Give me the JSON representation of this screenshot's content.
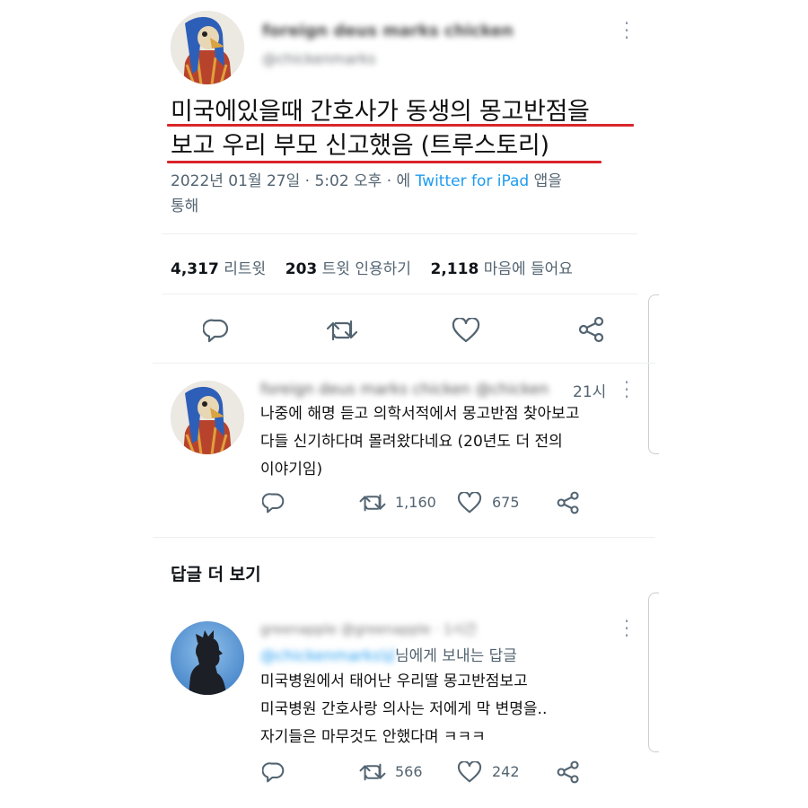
{
  "main_tweet": {
    "author_name": "foreign deus marks chicken",
    "author_handle": "@chickenmarks",
    "text_line1": "미국에있을때 간호사가 동생의 몽고반점을",
    "text_line2": "보고 우리 부모 신고했음 (트루스토리)",
    "meta_prefix": "2022년 01월 27일 · 5:02 오후 · 에 ",
    "meta_client": "Twitter for iPad",
    "meta_suffix_line1": " 앱을",
    "meta_suffix_line2": "통해",
    "retweet_count": "4,317",
    "retweet_label": "리트윗",
    "quote_count": "203",
    "quote_label": "트윗 인용하기",
    "like_count": "2,118",
    "like_label": "마음에 들어요"
  },
  "reply1": {
    "author_name": "foreign deus marks chicken @chicken",
    "time": "21시",
    "text_line1": "나중에 해명 듣고 의학서적에서 몽고반점 찾아보고",
    "text_line2": "다들 신기하다며 몰려왔다네요 (20년도 더 전의",
    "text_line3": "이야기임)",
    "retweet_count": "1,160",
    "like_count": "675"
  },
  "more_replies_title": "답글 더 보기",
  "reply2": {
    "author_name": "greenapple @greenapple · 1시간",
    "reply_to_blurred": "@chickenmarks님",
    "reply_to_suffix": "님에게 보내는 답글",
    "text_line1": "미국병원에서 태어난 우리딸 몽고반점보고",
    "text_line2": "미국병원 간호사랑 의사는 저에게 막 변명을..",
    "text_line3": "자기들은 마무것도 안했다며 ㅋㅋㅋ",
    "retweet_count": "566",
    "like_count": "242"
  },
  "colors": {
    "underline": "#d9252a",
    "link": "#1d9bf0",
    "icon": "#536471"
  },
  "icons": [
    "reply-icon",
    "retweet-icon",
    "like-icon",
    "share-icon",
    "more-icon"
  ]
}
